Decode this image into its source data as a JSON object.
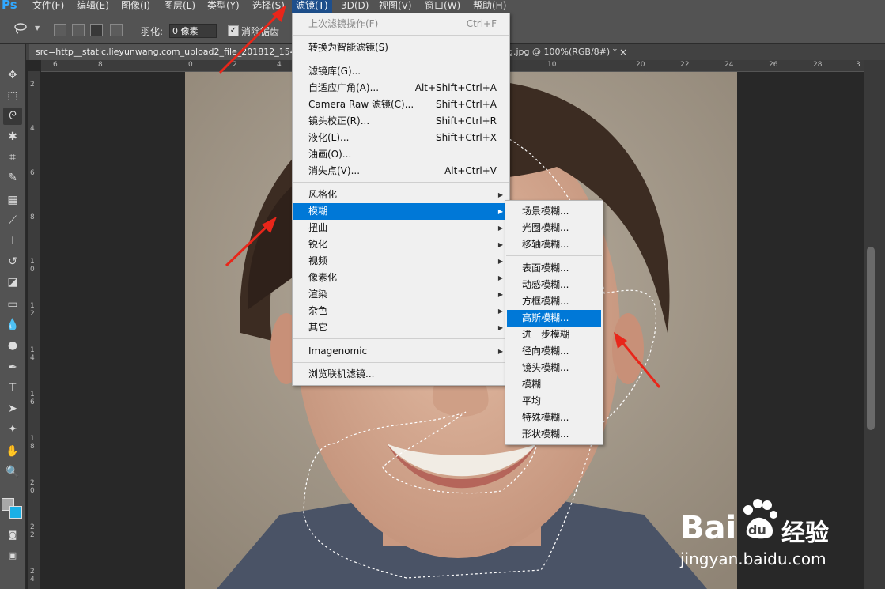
{
  "app": {
    "logo": "Ps"
  },
  "menubar": {
    "items": [
      "文件(F)",
      "编辑(E)",
      "图像(I)",
      "图层(L)",
      "类型(Y)",
      "选择(S)",
      "滤镜(T)",
      "3D(D)",
      "视图(V)",
      "窗口(W)",
      "帮助(H)"
    ],
    "active_index": 6
  },
  "options": {
    "feather_label": "羽化:",
    "feather_value": "0 像素",
    "antialias_label": "消除锯齿",
    "antialias_checked": true
  },
  "document": {
    "tab_title": "src=http__static.lieyunwang.com_upload2_file_201812_154",
    "tab_suffix": "g.jpg @ 100%(RGB/8#) *",
    "close_glyph": "×"
  },
  "rulers": {
    "h_ticks": [
      "6",
      "8",
      "0",
      "2",
      "4",
      "6",
      "8",
      "10",
      "20",
      "20",
      "22",
      "24",
      "26",
      "28",
      "3"
    ],
    "v_ticks": [
      "2",
      "4",
      "6",
      "8",
      "1 0",
      "1 2",
      "1 4",
      "1 6",
      "1 8",
      "2 0",
      "2 2",
      "2 4"
    ]
  },
  "filter_menu": {
    "items": [
      {
        "label": "上次滤镜操作(F)",
        "shortcut": "Ctrl+F",
        "disabled": true
      },
      {
        "label": "转换为智能滤镜(S)"
      },
      {
        "label": "滤镜库(G)..."
      },
      {
        "label": "自适应广角(A)...",
        "shortcut": "Alt+Shift+Ctrl+A"
      },
      {
        "label": "Camera Raw 滤镜(C)...",
        "shortcut": "Shift+Ctrl+A"
      },
      {
        "label": "镜头校正(R)...",
        "shortcut": "Shift+Ctrl+R"
      },
      {
        "label": "液化(L)...",
        "shortcut": "Shift+Ctrl+X"
      },
      {
        "label": "油画(O)..."
      },
      {
        "label": "消失点(V)...",
        "shortcut": "Alt+Ctrl+V"
      },
      {
        "label": "风格化",
        "submenu": true
      },
      {
        "label": "模糊",
        "submenu": true,
        "highlighted": true
      },
      {
        "label": "扭曲",
        "submenu": true
      },
      {
        "label": "锐化",
        "submenu": true
      },
      {
        "label": "视频",
        "submenu": true
      },
      {
        "label": "像素化",
        "submenu": true
      },
      {
        "label": "渲染",
        "submenu": true
      },
      {
        "label": "杂色",
        "submenu": true
      },
      {
        "label": "其它",
        "submenu": true
      },
      {
        "label": "Imagenomic",
        "submenu": true
      },
      {
        "label": "浏览联机滤镜..."
      }
    ]
  },
  "blur_submenu": {
    "items": [
      "场景模糊...",
      "光圈模糊...",
      "移轴模糊...",
      "表面模糊...",
      "动感模糊...",
      "方框模糊...",
      "高斯模糊...",
      "进一步模糊",
      "径向模糊...",
      "镜头模糊...",
      "模糊",
      "平均",
      "特殊模糊...",
      "形状模糊..."
    ],
    "highlighted_index": 6
  },
  "watermark": {
    "brand": "Bai",
    "brand2": "百",
    "brand3": "du",
    "cn": "经验",
    "url": "jingyan.baidu.com"
  },
  "colors": {
    "accent": "#0078d7",
    "annotation_arrow": "#e8261a",
    "panel": "#535353"
  }
}
